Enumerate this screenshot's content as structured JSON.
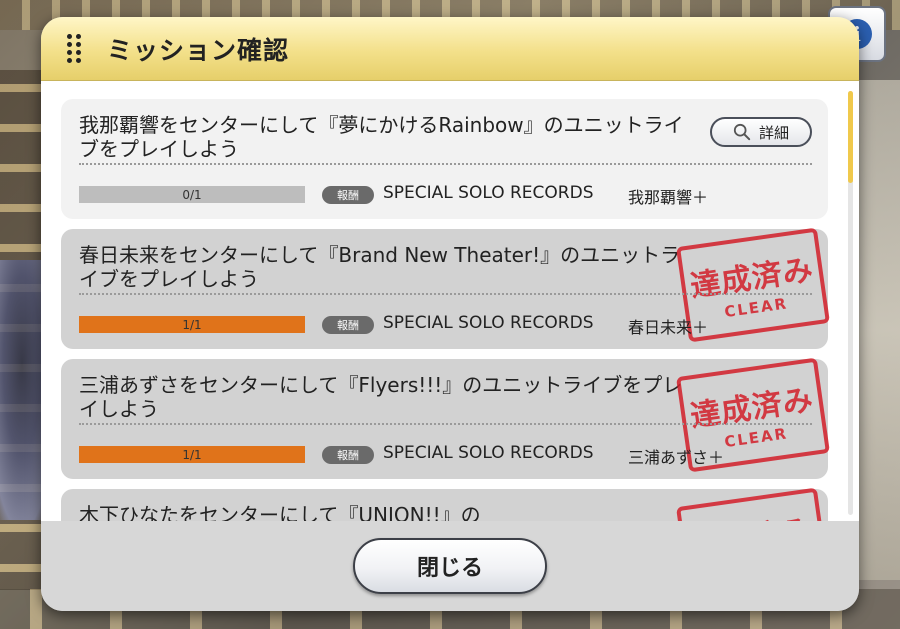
{
  "dialog": {
    "title": "ミッション確認",
    "close_label": "閉じる"
  },
  "info_button": {
    "icon": "info-icon",
    "label": "i"
  },
  "reward_badge_label": "報酬",
  "detail_label": "詳細",
  "stamp": {
    "main": "達成済み",
    "sub": "CLEAR"
  },
  "missions": [
    {
      "text": "我那覇響をセンターにして『夢にかけるRainbow』のユニットライブをプレイしよう",
      "progress_text": "0/1",
      "progress": 0,
      "reward": "SPECIAL SOLO RECORDS",
      "reward_item": "我那覇響＋",
      "completed": false
    },
    {
      "text": "春日未来をセンターにして『Brand New Theater!』のユニットライブをプレイしよう",
      "progress_text": "1/1",
      "progress": 1,
      "reward": "SPECIAL SOLO RECORDS",
      "reward_item": "春日未来＋",
      "completed": true
    },
    {
      "text": "三浦あずさをセンターにして『Flyers!!!』のユニットライブをプレイしよう",
      "progress_text": "1/1",
      "progress": 1,
      "reward": "SPECIAL SOLO RECORDS",
      "reward_item": "三浦あずさ＋",
      "completed": true
    },
    {
      "text": "木下ひなたをセンターにして『UNION!!』の",
      "completed": true
    }
  ],
  "colors": {
    "header": "#f3e08a",
    "progress_fill": "#e0731a",
    "stamp": "#d31f2a"
  }
}
